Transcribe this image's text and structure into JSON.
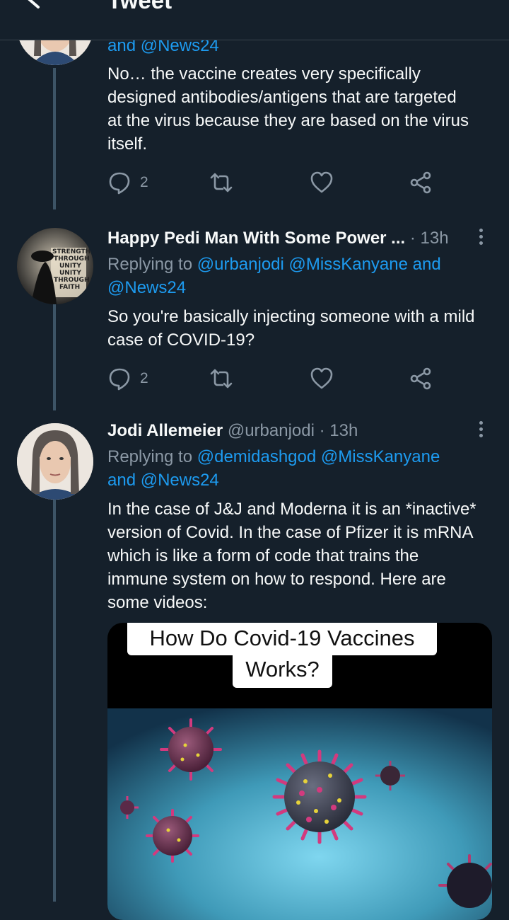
{
  "header": {
    "title": "Tweet",
    "back_icon": "arrow-left-icon"
  },
  "tweets": [
    {
      "partial_reply_line": "and @News24",
      "text_lines": [
        "No… the vaccine creates very specifically",
        "designed antibodies/antigens that are targeted",
        "at the virus because they are based on the virus",
        "itself."
      ],
      "reply_count": "2"
    },
    {
      "display_name": "Happy Pedi Man With Some Power ...",
      "time": "· 13h",
      "replying_label": "Replying to",
      "mentions_line1": "@urbanjodi @MissKanyane and",
      "mentions_line2": "@News24",
      "text_lines": [
        "So you're basically injecting someone with a mild",
        "case of COVID-19?"
      ],
      "reply_count": "2",
      "avatar_lines": [
        "STRENGTH",
        "THROUGH",
        "UNITY",
        "UNITY",
        "THROUGH",
        "FAITH"
      ]
    },
    {
      "display_name": "Jodi Allemeier",
      "handle": "@urbanjodi",
      "time": "· 13h",
      "replying_label": "Replying to",
      "mentions_line1": "@demidashgod @MissKanyane",
      "mentions_line2": "and @News24",
      "text_lines": [
        "In the case of J&J and Moderna it is an *inactive*",
        "version of Covid. In the case of Pfizer it is mRNA",
        "which is like a form of code that trains the",
        "immune system on how to respond. Here are",
        "some videos:"
      ],
      "media": {
        "caption_line1": "How Do Covid-19 Vaccines",
        "caption_line2": "Works?"
      }
    }
  ],
  "colors": {
    "background": "#15202b",
    "text": "#f7f9f9",
    "muted": "#8b98a5",
    "link": "#1d9bf0"
  }
}
